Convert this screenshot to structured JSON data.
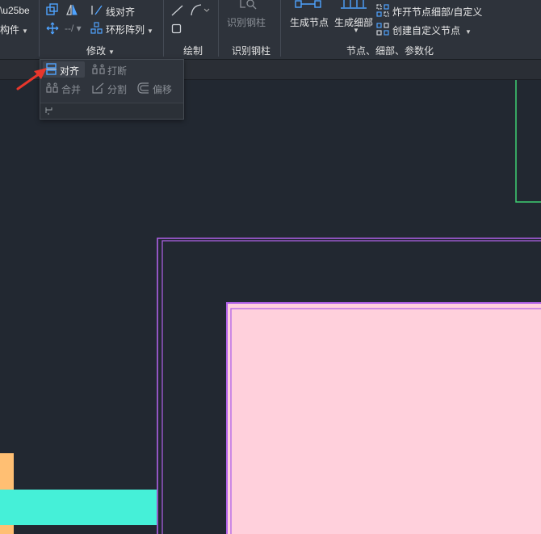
{
  "ribbon": {
    "left_partial": {
      "item1": "构件"
    },
    "modify": {
      "line_align": "线对齐",
      "ring_array": "环形阵列",
      "group_label": "修改"
    },
    "draw": {
      "group_label": "绘制"
    },
    "identify": {
      "button": "识别钢柱",
      "group_label": "识别钢柱"
    },
    "nodes": {
      "gen_node": "生成节点",
      "gen_detail": "生成细部",
      "explode": "炸开节点细部/自定义",
      "create_custom": "创建自定义节点",
      "group_label": "节点、细部、参数化"
    }
  },
  "popup": {
    "align": "对齐",
    "break": "打断",
    "merge": "合并",
    "split": "分割",
    "offset": "偏移"
  },
  "colors": {
    "canvas": "#222831",
    "ribbon": "#2e333b",
    "magenta_outline": "#b061e8",
    "pink_fill": "#ffd0dc",
    "green_line": "#3ecf73",
    "cyan_bar": "#45f0d8",
    "orange_block": "#ffbf73",
    "arrow_red": "#e8372c",
    "icon_blue": "#4fa3ff"
  }
}
